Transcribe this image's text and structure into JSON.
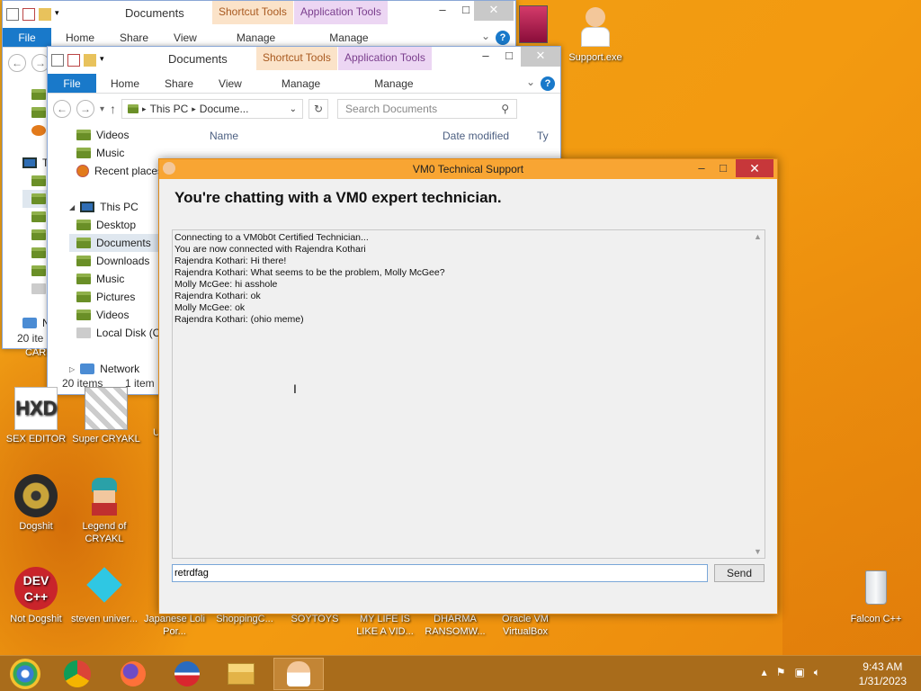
{
  "desktop": {
    "icons": [
      {
        "label": "Support.exe"
      },
      {
        "label": "SEX EDITOR"
      },
      {
        "label": "Super CRYAKL"
      },
      {
        "label": "Dogshit"
      },
      {
        "label": "Legend of CRYAKL"
      },
      {
        "label": "Not Dogshit"
      },
      {
        "label": "steven univer..."
      },
      {
        "label": "Japanese Loli Por..."
      },
      {
        "label": "ShoppingC..."
      },
      {
        "label": "SOYTOYS"
      },
      {
        "label": "MY LIFE IS LIKE A VID..."
      },
      {
        "label": "DHARMA RANSOMW..."
      },
      {
        "label": "Oracle VM VirtualBox"
      },
      {
        "label": "Falcon C++"
      }
    ],
    "partial_labels": {
      "car": "CAR",
      "u": "U"
    }
  },
  "explorer_back": {
    "title": "Documents",
    "context_tabs": [
      "Shortcut Tools",
      "Application Tools"
    ],
    "ribbon_tabs": [
      "File",
      "Home",
      "Share",
      "View",
      "Manage",
      "Manage"
    ],
    "partial_letters": [
      "T",
      "N"
    ],
    "status_items": "20 ite"
  },
  "explorer_front": {
    "title": "Documents",
    "context_tabs": [
      "Shortcut Tools",
      "Application Tools"
    ],
    "ribbon_tabs": [
      "File",
      "Home",
      "Share",
      "View",
      "Manage",
      "Manage"
    ],
    "address": {
      "root": "This PC",
      "current": "Docume..."
    },
    "search_placeholder": "Search Documents",
    "columns": [
      "Name",
      "Date modified",
      "Ty"
    ],
    "quick_access": [
      "Videos",
      "Music",
      "Recent places"
    ],
    "this_pc_label": "This PC",
    "this_pc_items": [
      "Desktop",
      "Documents",
      "Downloads",
      "Music",
      "Pictures",
      "Videos",
      "Local Disk (C"
    ],
    "network_label": "Network",
    "status": {
      "items": "20 items",
      "selected": "1 item"
    }
  },
  "chat": {
    "window_title": "VM0 Technical Support",
    "header": "You're chatting with a VM0 expert technician.",
    "log": [
      "Connecting to a VM0b0t Certified Technician...",
      "You are now connected with Rajendra Kothari",
      "Rajendra Kothari: Hi there!",
      "Rajendra Kothari: What seems to be the problem, Molly McGee?",
      "Molly McGee: hi asshole",
      "Rajendra Kothari: ok",
      "Molly McGee: ok",
      "Rajendra Kothari: (ohio meme)"
    ],
    "input_value": "retrdfag",
    "send_label": "Send"
  },
  "taskbar": {
    "apps": [
      "start-icon",
      "chrome-icon",
      "firefox-icon",
      "obama-icon",
      "file-explorer-icon",
      "support-icon"
    ],
    "time": "9:43 AM",
    "date": "1/31/2023"
  },
  "colors": {
    "accent": "#1979ca",
    "chat_title": "#f8a533",
    "close_red": "#c7373a",
    "taskbar": "#a96c1b"
  }
}
